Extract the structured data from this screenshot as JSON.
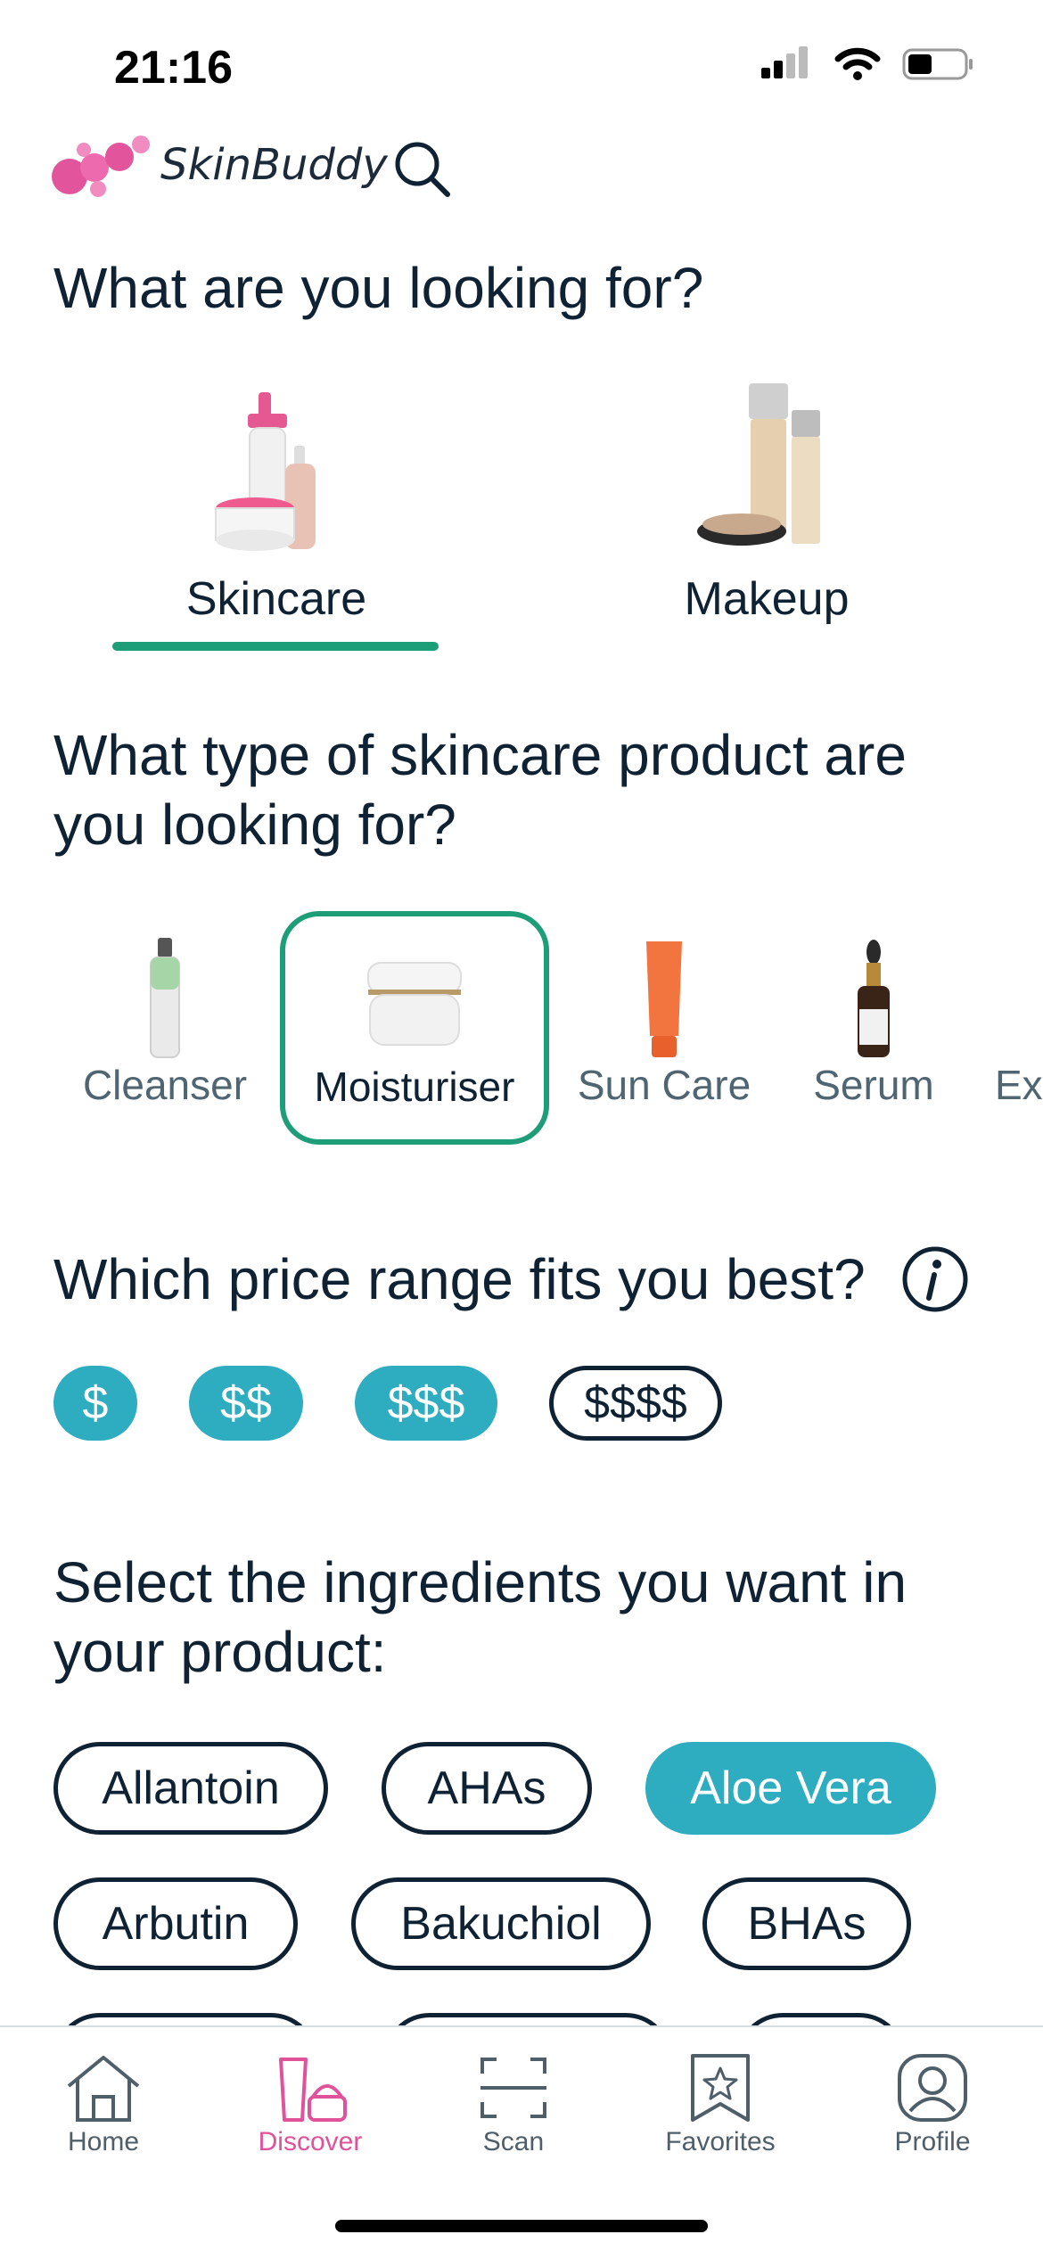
{
  "status": {
    "time": "21:16"
  },
  "app": {
    "name": "SkinBuddy"
  },
  "category_section": {
    "heading": "What are you looking for?",
    "categories": [
      {
        "label": "Skincare",
        "selected": true
      },
      {
        "label": "Makeup",
        "selected": false
      }
    ]
  },
  "product_section": {
    "heading": "What type of skincare product are you looking for?",
    "types": [
      {
        "label": "Cleanser",
        "selected": false
      },
      {
        "label": "Moisturiser",
        "selected": true
      },
      {
        "label": "Sun Care",
        "selected": false
      },
      {
        "label": "Serum",
        "selected": false
      },
      {
        "label": "Ex",
        "selected": false
      }
    ]
  },
  "price_section": {
    "heading": "Which price range fits you best?",
    "ranges": [
      {
        "label": "$",
        "selected": true
      },
      {
        "label": "$$",
        "selected": true
      },
      {
        "label": "$$$",
        "selected": true
      },
      {
        "label": "$$$$",
        "selected": false
      }
    ]
  },
  "ingredients_section": {
    "heading": "Select the ingredients you want in your product:",
    "ingredients": [
      {
        "label": "Allantoin",
        "selected": false
      },
      {
        "label": "AHAs",
        "selected": false
      },
      {
        "label": "Aloe Vera",
        "selected": true
      },
      {
        "label": "Arbutin",
        "selected": false
      },
      {
        "label": "Bakuchiol",
        "selected": false
      },
      {
        "label": "BHAs",
        "selected": false
      }
    ]
  },
  "nav": {
    "items": [
      {
        "label": "Home",
        "icon": "home-icon"
      },
      {
        "label": "Discover",
        "icon": "discover-icon",
        "active": true
      },
      {
        "label": "Scan",
        "icon": "scan-icon"
      },
      {
        "label": "Favorites",
        "icon": "favorites-icon"
      },
      {
        "label": "Profile",
        "icon": "profile-icon"
      }
    ]
  },
  "colors": {
    "accent_green": "#1e9e78",
    "chip_teal": "#2eadc0",
    "brand_pink": "#e0529a",
    "text_dark": "#0f2233"
  }
}
